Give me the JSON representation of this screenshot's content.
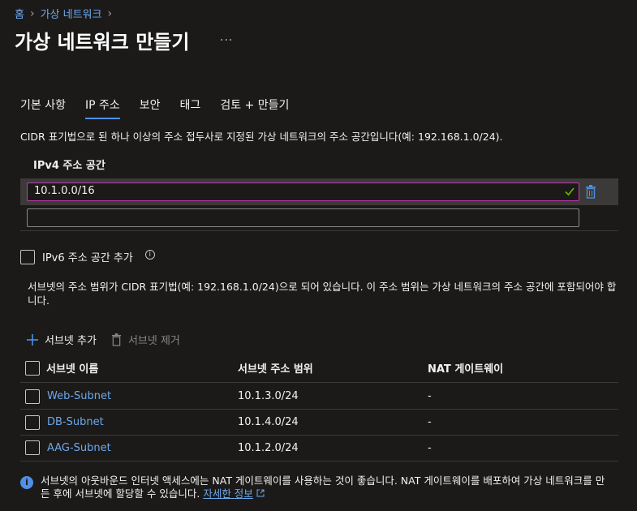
{
  "breadcrumb": {
    "home": "홈",
    "current": "가상 네트워크"
  },
  "page": {
    "title": "가상 네트워크 만들기",
    "more": "..."
  },
  "tabs": [
    {
      "label": "기본 사항"
    },
    {
      "label": "IP 주소"
    },
    {
      "label": "보안"
    },
    {
      "label": "태그"
    },
    {
      "label": "검토 + 만들기"
    }
  ],
  "active_tab": "IP 주소",
  "description": "CIDR 표기법으로 된 하나 이상의 주소 접두사로 지정된 가상 네트워크의 주소 공간입니다(예: 192.168.1.0/24).",
  "ipv4": {
    "header": "IPv4 주소 공간",
    "value": "10.1.0.0/16",
    "empty_value": ""
  },
  "ipv6": {
    "label": "IPv6 주소 공간 추가",
    "checked": false
  },
  "subnet_note": "서브넷의 주소 범위가 CIDR 표기법(예: 192.168.1.0/24)으로 되어 있습니다. 이 주소 범위는 가상 네트워크의 주소 공간에 포함되어야 합니다.",
  "actions": {
    "add": "서브넷 추가",
    "remove": "서브넷 제거"
  },
  "table": {
    "headers": [
      "서브넷 이름",
      "서브넷 주소 범위",
      "NAT 게이트웨이"
    ],
    "rows": [
      {
        "name": "Web-Subnet",
        "range": "10.1.3.0/24",
        "nat": "-"
      },
      {
        "name": "DB-Subnet",
        "range": "10.1.4.0/24",
        "nat": "-"
      },
      {
        "name": "AAG-Subnet",
        "range": "10.1.2.0/24",
        "nat": "-"
      }
    ]
  },
  "info": {
    "text": "서브넷의 아웃바운드 인터넷 액세스에는 NAT 게이트웨이를 사용하는 것이 좋습니다. NAT 게이트웨이를 배포하여 가상 네트워크를 만든 후에 서브넷에 할당할 수 있습니다.",
    "link": "자세한 정보"
  },
  "colors": {
    "accent": "#4f8fe6",
    "link": "#6ea8ea",
    "focus_border": "#c239b3",
    "background": "#1b1a19",
    "check": "#6bb700"
  }
}
